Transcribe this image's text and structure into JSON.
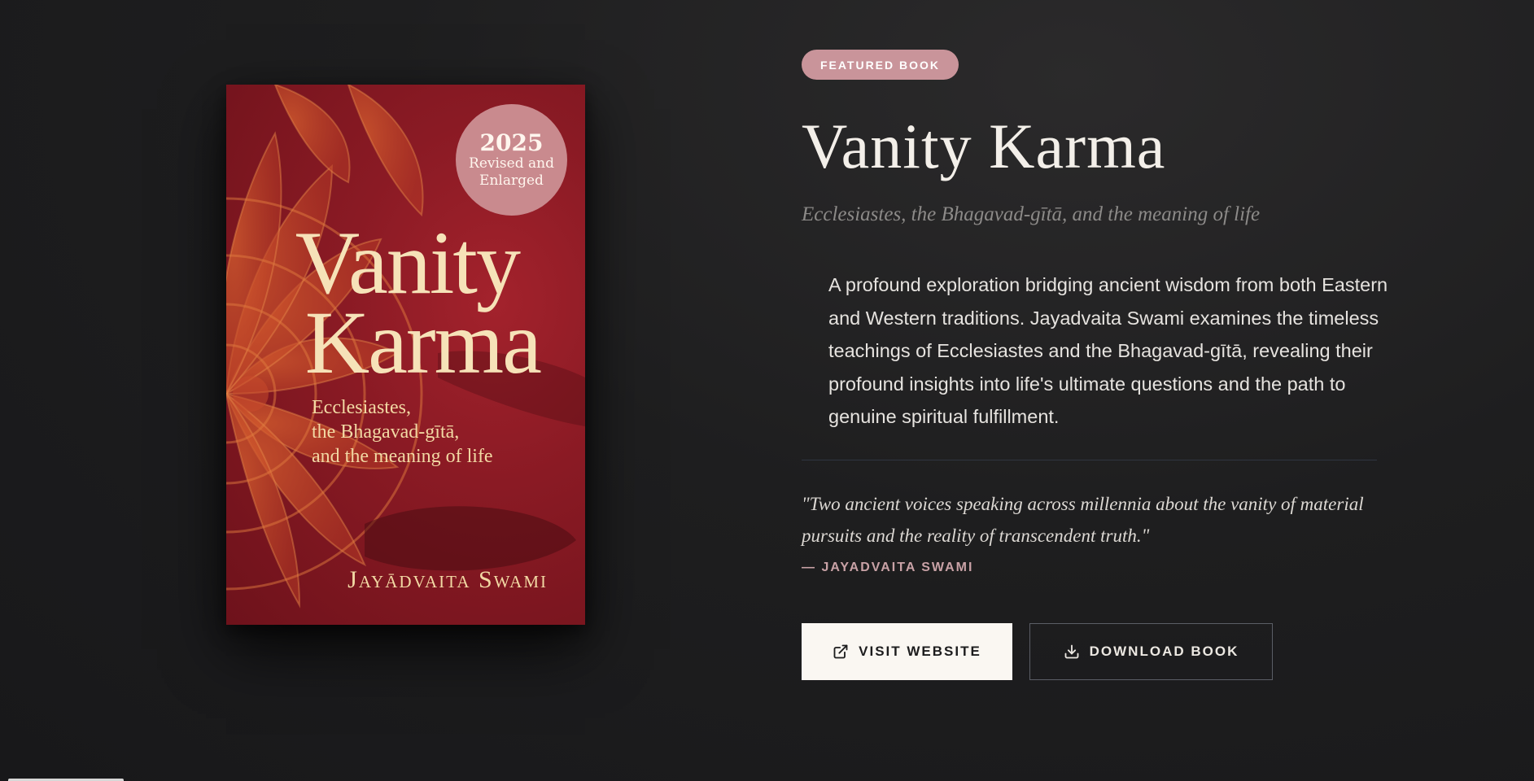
{
  "cover": {
    "badge_year": "2025",
    "badge_line1": "Revised and",
    "badge_line2": "Enlarged",
    "title_line1": "Vanity",
    "title_line2": "Karma",
    "subtitle_line1": "Ecclesiastes,",
    "subtitle_line2": "the Bhagavad-gītā,",
    "subtitle_line3": "and the meaning of life",
    "author": "Jayādvaita Swami"
  },
  "featured": {
    "tag": "FEATURED BOOK",
    "title": "Vanity Karma",
    "subtitle": "Ecclesiastes, the Bhagavad-gītā, and the meaning of life",
    "description": "A profound exploration bridging ancient wisdom from both Eastern and Western traditions. Jayadvaita Swami examines the timeless teachings of Ecclesiastes and the Bhagavad-gītā, revealing their profound insights into life's ultimate questions and the path to genuine spiritual fulfillment.",
    "quote": "\"Two ancient voices speaking across millennia about the vanity of material pursuits and the reality of transcendent truth.\"",
    "attribution": "— JAYADVAITA SWAMI"
  },
  "actions": {
    "visit_label": "VISIT WEBSITE",
    "visit_icon": "external-link-icon",
    "download_label": "DOWNLOAD BOOK",
    "download_icon": "download-icon"
  },
  "colors": {
    "background": "#1e1e1f",
    "accent_pink": "#c9949a",
    "cover_red": "#8a1a24",
    "cover_gold": "#f6e2b8",
    "button_light": "#faf7f2"
  }
}
